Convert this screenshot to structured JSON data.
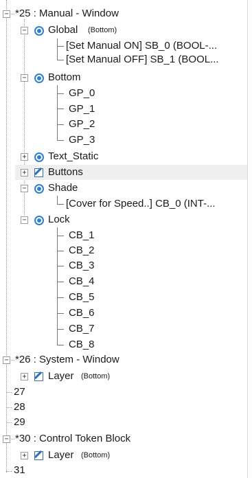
{
  "tree": {
    "win25": {
      "label": "*25 : Manual - Window",
      "toggle": "−"
    },
    "global": {
      "label": "Global",
      "sub": "(Bottom)",
      "toggle": "−",
      "icon": "eye-icon"
    },
    "sb0": {
      "label": "[Set Manual ON] SB_0 (BOOL-..."
    },
    "sb1": {
      "label": "[Set Manual OFF] SB_1 (BOOL..."
    },
    "bottom": {
      "label": "Bottom",
      "toggle": "−",
      "icon": "eye-icon"
    },
    "gp": [
      "GP_0",
      "GP_1",
      "GP_2",
      "GP_3"
    ],
    "text_static": {
      "label": "Text_Static",
      "toggle": "+",
      "icon": "eye-icon"
    },
    "buttons": {
      "label": "Buttons",
      "toggle": "+",
      "icon": "edit-icon"
    },
    "shade": {
      "label": "Shade",
      "toggle": "−",
      "icon": "eye-icon"
    },
    "cb0": {
      "label": "[Cover for Speed..] CB_0 (INT-..."
    },
    "lock": {
      "label": "Lock",
      "toggle": "−",
      "icon": "eye-icon"
    },
    "cb": [
      "CB_1",
      "CB_2",
      "CB_3",
      "CB_4",
      "CB_5",
      "CB_6",
      "CB_7",
      "CB_8"
    ],
    "win26": {
      "label": "*26 : System - Window",
      "toggle": "−"
    },
    "layer26": {
      "label": "Layer",
      "sub": "(Bottom)",
      "toggle": "+",
      "icon": "edit-icon"
    },
    "n27": "27",
    "n28": "28",
    "n29": "29",
    "win30": {
      "label": "*30 : Control Token Block",
      "toggle": "−"
    },
    "layer30": {
      "label": "Layer",
      "sub": "(Bottom)",
      "toggle": "+",
      "icon": "edit-icon"
    },
    "n31": "31"
  }
}
